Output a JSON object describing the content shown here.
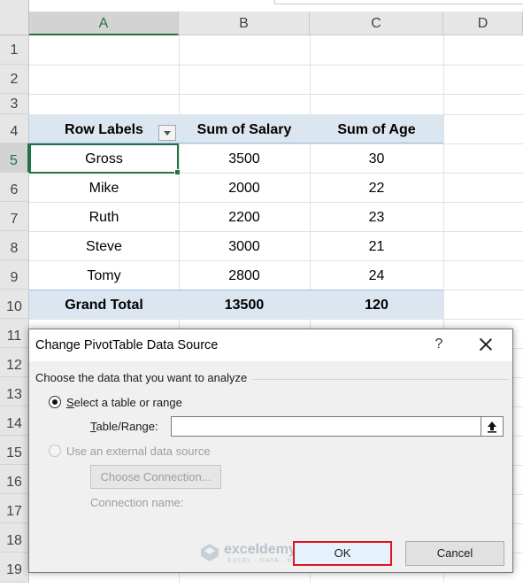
{
  "columns": [
    "A",
    "B",
    "C",
    "D"
  ],
  "rows": [
    "1",
    "2",
    "3",
    "4",
    "5",
    "6",
    "7",
    "8",
    "9",
    "10",
    "11",
    "12",
    "13",
    "14",
    "15",
    "16",
    "17",
    "18",
    "19"
  ],
  "pivot": {
    "headers": [
      "Row Labels",
      "Sum of Salary",
      "Sum of Age"
    ],
    "rows": [
      [
        "Gross",
        "3500",
        "30"
      ],
      [
        "Mike",
        "2000",
        "22"
      ],
      [
        "Ruth",
        "2200",
        "23"
      ],
      [
        "Steve",
        "3000",
        "21"
      ],
      [
        "Tomy",
        "2800",
        "24"
      ]
    ],
    "total": [
      "Grand Total",
      "13500",
      "120"
    ]
  },
  "dialog": {
    "title": "Change PivotTable Data Source",
    "help": "?",
    "section": "Choose the data that you want to analyze",
    "option_select_prefix": "",
    "option_select": "Select a table or range",
    "table_range_label": "Table/Range:",
    "table_range_value": "",
    "option_external": "Use an external data source",
    "choose_connection": "Choose Connection...",
    "connection_name_label": "Connection name:",
    "ok": "OK",
    "cancel": "Cancel"
  },
  "watermark": {
    "brand": "exceldemy",
    "tagline": "EXCEL · DATA · BI"
  },
  "icons": {
    "range_selector": "collapse-dialog-icon",
    "close": "close-icon"
  },
  "colors": {
    "excel_green": "#217346",
    "pivot_band": "#dce6f1",
    "ok_highlight": "#e0131f"
  }
}
